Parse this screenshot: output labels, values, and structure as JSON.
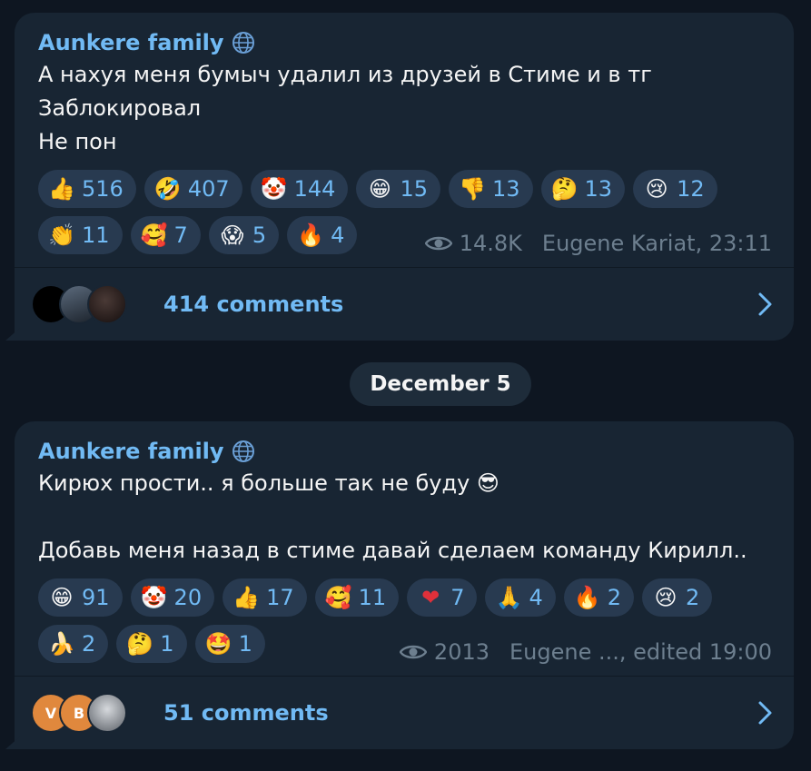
{
  "posts": [
    {
      "channel": "Aunkere family",
      "lines": [
        "А нахуя меня бумыч удалил из друзей в Стиме и в тг",
        "Заблокировал",
        "Не пон"
      ],
      "reactions": [
        {
          "emoji": "👍",
          "count": "516"
        },
        {
          "emoji": "🤣",
          "count": "407"
        },
        {
          "emoji": "🤡",
          "count": "144"
        },
        {
          "emoji": "😁",
          "count": "15"
        },
        {
          "emoji": "👎",
          "count": "13"
        },
        {
          "emoji": "🤔",
          "count": "13"
        },
        {
          "emoji": "😢",
          "count": "12"
        },
        {
          "emoji": "👏",
          "count": "11"
        },
        {
          "emoji": "🥰",
          "count": "7"
        },
        {
          "emoji": "😱",
          "count": "5"
        },
        {
          "emoji": "🔥",
          "count": "4"
        }
      ],
      "views": "14.8K",
      "author_time": "Eugene Kariat, 23:11",
      "comments_label": "414 comments",
      "avatars": [
        {
          "label": "",
          "color": "#000000"
        },
        {
          "label": "",
          "color": "#2c3440"
        },
        {
          "label": "",
          "color": "#2a1e1e"
        }
      ]
    },
    {
      "channel": "Aunkere family",
      "lines": [
        "Кирюх прости.. я больше так не буду 😎",
        "",
        "Добавь меня назад в стиме давай сделаем команду Кирилл.."
      ],
      "reactions": [
        {
          "emoji": "😁",
          "count": "91"
        },
        {
          "emoji": "🤡",
          "count": "20"
        },
        {
          "emoji": "👍",
          "count": "17"
        },
        {
          "emoji": "🥰",
          "count": "11"
        },
        {
          "emoji": "❤",
          "count": "7"
        },
        {
          "emoji": "🙏",
          "count": "4"
        },
        {
          "emoji": "🔥",
          "count": "2"
        },
        {
          "emoji": "😢",
          "count": "2"
        },
        {
          "emoji": "🍌",
          "count": "2"
        },
        {
          "emoji": "🤔",
          "count": "1"
        },
        {
          "emoji": "🤩",
          "count": "1"
        }
      ],
      "views": "2013",
      "author_time": "Eugene ..., edited 19:00",
      "comments_label": "51 comments",
      "avatars": [
        {
          "label": "V",
          "color": "#e0883d"
        },
        {
          "label": "B",
          "color": "#e0883d"
        },
        {
          "label": "",
          "color": "#8a8f96"
        }
      ]
    }
  ],
  "date_separator": "December 5",
  "colors": {
    "background": "#0e1621",
    "bubble": "#182533",
    "accent": "#71baf4",
    "reaction_bg": "#283a50",
    "meta": "#6d7f8f"
  }
}
